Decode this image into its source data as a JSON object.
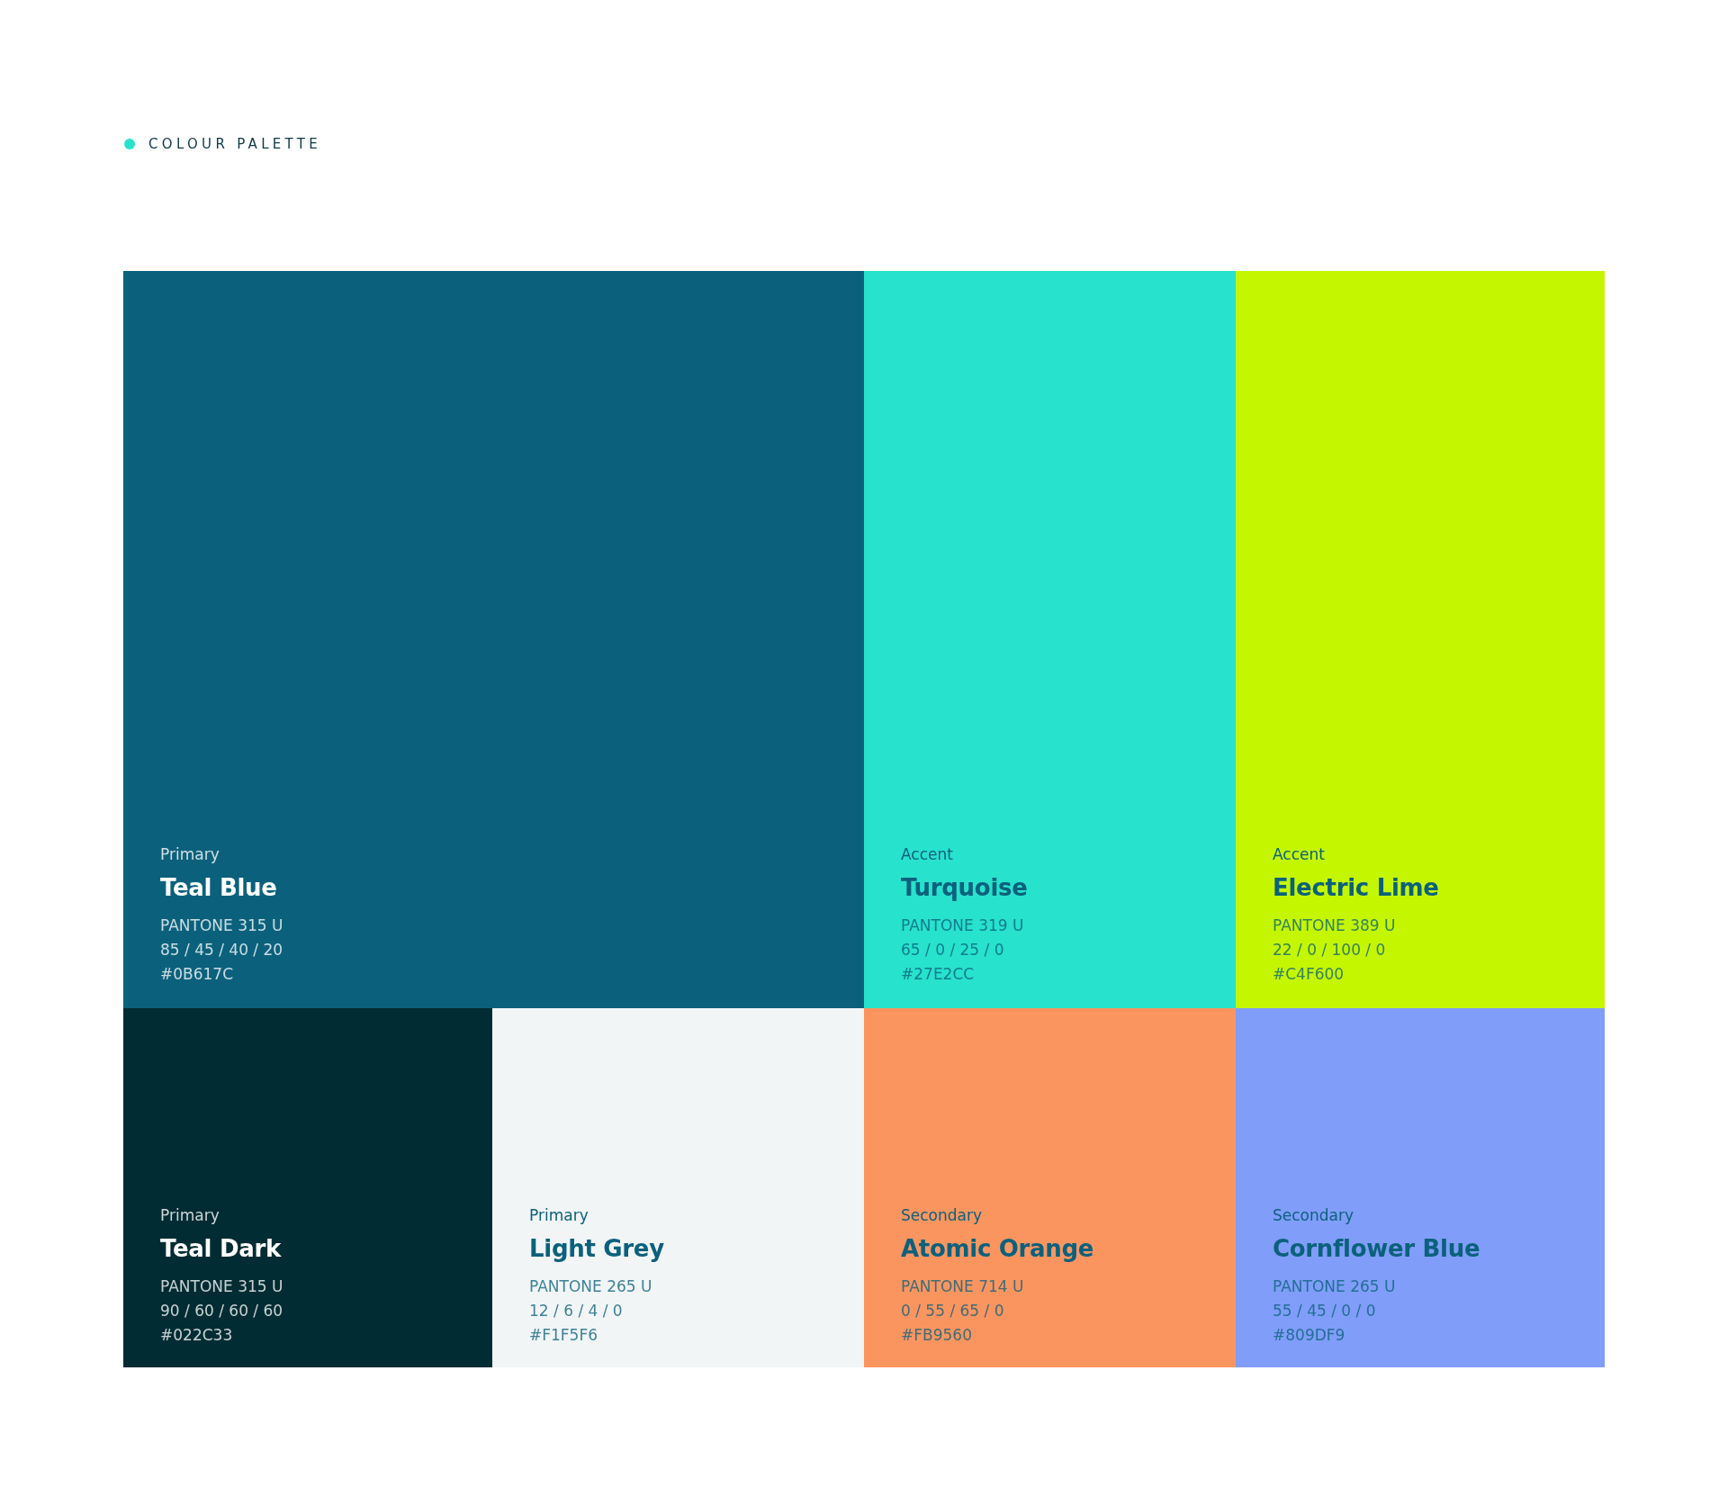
{
  "header": {
    "title": "COLOUR PALETTE",
    "color": "#27e2cc"
  },
  "swatches": [
    {
      "role": "Primary",
      "name": "Teal Blue",
      "pantone": "PANTONE 315 U",
      "cmyk": "85 / 45 / 40 / 20",
      "hex": "#0B617C",
      "color": "#0b617c",
      "kind": "wide"
    },
    {
      "role": "Accent",
      "name": "Turquoise",
      "pantone": "PANTONE 319 U",
      "cmyk": "65 / 0 / 25 / 0",
      "hex": "#27E2CC",
      "color": "#27e2cc",
      "kind": "tall"
    },
    {
      "role": "Accent",
      "name": "Electric Lime",
      "pantone": "PANTONE 389 U",
      "cmyk": "22 / 0 / 100 / 0",
      "hex": "#C4F600",
      "color": "#c4f600",
      "kind": "tall"
    },
    {
      "role": "Primary",
      "name": "Teal Dark",
      "pantone": "PANTONE 315 U",
      "cmyk": "90 / 60 / 60 / 60",
      "hex": "#022C33",
      "color": "#022c33",
      "kind": "small"
    },
    {
      "role": "Primary",
      "name": "Light Grey",
      "pantone": "PANTONE 265 U",
      "cmyk": "12 / 6 / 4 / 0",
      "hex": "#F1F5F6",
      "color": "#f1f5f6",
      "kind": "small"
    },
    {
      "role": "Secondary",
      "name": "Atomic Orange",
      "pantone": "PANTONE 714 U",
      "cmyk": "0 / 55 / 65 / 0",
      "hex": "#FB9560",
      "color": "#fb9560",
      "kind": "small"
    },
    {
      "role": "Secondary",
      "name": "Cornflower Blue",
      "pantone": "PANTONE 265 U",
      "cmyk": "55 / 45 / 0 / 0",
      "hex": "#809DF9",
      "color": "#809df9",
      "kind": "small"
    }
  ]
}
